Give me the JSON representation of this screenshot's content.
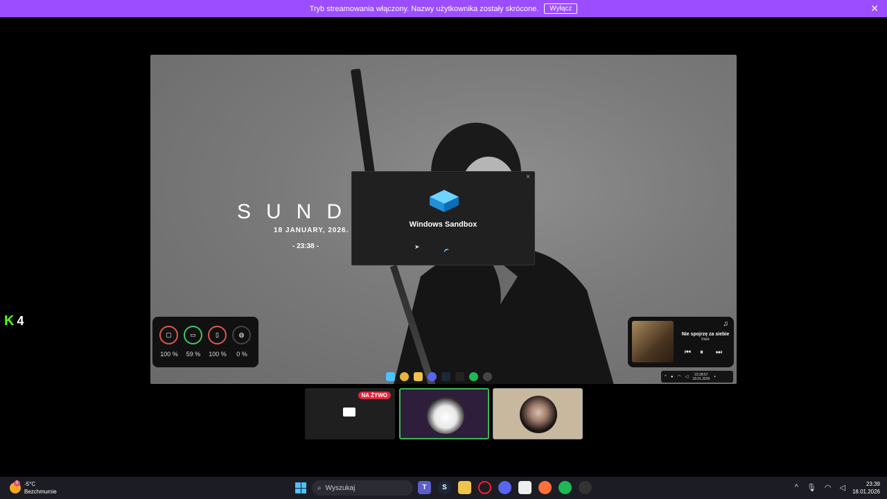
{
  "banner": {
    "message": "Tryb streamowania włączony. Nazwy użytkownika zostały skrócone.",
    "button": "Wyłącz"
  },
  "wallpaper": {
    "brand": "SUNDA",
    "date": "18 JANUARY, 2026.",
    "time": "- 23:38 -"
  },
  "dialog": {
    "title": "Windows Sandbox",
    "close": "×"
  },
  "stats": [
    {
      "icon": "cpu-icon",
      "value": "100 %",
      "color": "#e05a4a"
    },
    {
      "icon": "memory-icon",
      "value": "59 %",
      "color": "#3fc96b"
    },
    {
      "icon": "disk-icon",
      "value": "100 %",
      "color": "#e05a4a"
    },
    {
      "icon": "network-icon",
      "value": "0 %",
      "color": "#444444"
    }
  ],
  "player": {
    "song": "Nie spojrzę za siebie",
    "artist": "Inee"
  },
  "mini_tray": {
    "time": "23:38:57",
    "date": "18.01.2026"
  },
  "k4": "4",
  "live_badge": "NA ŻYWO",
  "taskbar": {
    "temperature": "-5°C",
    "condition": "Bezchmurnie",
    "weather_badge": "5",
    "search_placeholder": "Wyszukaj",
    "time": "23:39",
    "date": "18.01.2026"
  }
}
